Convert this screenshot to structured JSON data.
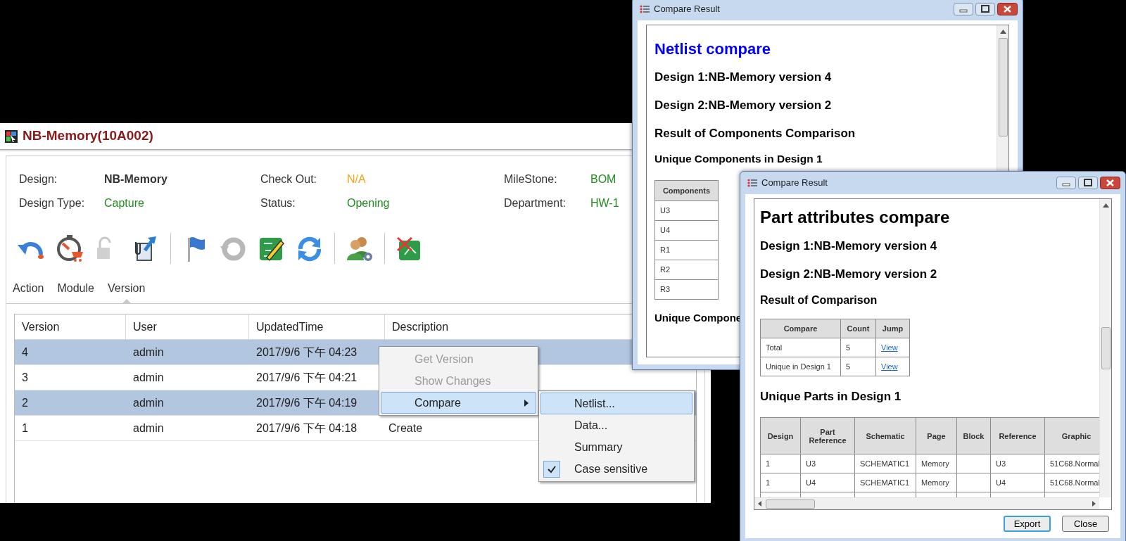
{
  "main_window": {
    "title": "NB-Memory(10A002)",
    "fields": [
      {
        "label": "Design:",
        "value": "NB-Memory",
        "color": "#333333",
        "bold": true
      },
      {
        "label": "Check Out:",
        "value": "N/A",
        "color": "#f5a31a",
        "bold": false
      },
      {
        "label": "MileStone:",
        "value": "BOM",
        "color": "#1f8a1f",
        "bold": false
      },
      {
        "label": "Design Type:",
        "value": "Capture",
        "color": "#1f8a1f",
        "bold": false
      },
      {
        "label": "Status:",
        "value": "Opening",
        "color": "#1f8a1f",
        "bold": false
      },
      {
        "label": "Department:",
        "value": "HW-1",
        "color": "#1f8a1f",
        "bold": false
      }
    ],
    "tabs": [
      {
        "label": "Action",
        "selected": false
      },
      {
        "label": "Module",
        "selected": false
      },
      {
        "label": "Version",
        "selected": true
      }
    ],
    "version_table": {
      "columns": [
        "Version",
        "User",
        "UpdatedTime",
        "Description"
      ],
      "rows": [
        {
          "version": "4",
          "user": "admin",
          "updated_time": "2017/9/6 下午 04:23",
          "selected": true
        },
        {
          "version": "3",
          "user": "admin",
          "updated_time": "2017/9/6 下午 04:21",
          "selected": false
        },
        {
          "version": "2",
          "user": "admin",
          "updated_time": "2017/9/6 下午 04:19",
          "selected": true
        },
        {
          "version": "1",
          "user": "admin",
          "updated_time": "2017/9/6 下午 04:18",
          "description": "Create",
          "selected": false
        }
      ]
    }
  },
  "context_menu": {
    "items": [
      {
        "label": "Get Version",
        "disabled": true,
        "selected": false,
        "submenu": false
      },
      {
        "label": "Show Changes",
        "disabled": true,
        "selected": false,
        "submenu": false
      },
      {
        "label": "Compare",
        "disabled": false,
        "selected": true,
        "submenu": true
      }
    ]
  },
  "submenu": {
    "items": [
      {
        "label": "Netlist...",
        "selected": true,
        "checked": false
      },
      {
        "label": "Data...",
        "selected": false,
        "checked": false
      },
      {
        "label": "Summary",
        "selected": false,
        "checked": false
      },
      {
        "label": "Case sensitive",
        "selected": false,
        "checked": true
      }
    ]
  },
  "netlist_window": {
    "title": "Compare Result",
    "heading": "Netlist compare",
    "design_lines": [
      "Design 1:NB-Memory version 4",
      "Design 2:NB-Memory version 2"
    ],
    "section_title": "Result of Components Comparison",
    "subsection_title": "Unique Components in Design 1",
    "components_table": {
      "column": "Components",
      "rows": [
        "U3",
        "U4",
        "R1",
        "R2",
        "R3"
      ]
    },
    "next_section": "Unique Compone"
  },
  "part_window": {
    "title": "Compare Result",
    "heading": "Part attributes compare",
    "design_lines": [
      "Design 1:NB-Memory version 4",
      "Design 2:NB-Memory version 2"
    ],
    "section_title": "Result of Comparison",
    "summary_table": {
      "columns": [
        "Compare",
        "Count",
        "Jump"
      ],
      "rows": [
        {
          "compare": "Total",
          "count": "5",
          "jump": "View"
        },
        {
          "compare": "Unique in Design 1",
          "count": "5",
          "jump": "View"
        }
      ]
    },
    "parts_title": "Unique Parts in Design 1",
    "parts_table": {
      "columns": [
        "Design",
        "Part Reference",
        "Schematic",
        "Page",
        "Block",
        "Reference",
        "Graphic"
      ],
      "rows": [
        {
          "design": "1",
          "part_reference": "U3",
          "schematic": "SCHEMATIC1",
          "page": "Memory",
          "reference": "U3",
          "graphic": "51C68.Normal"
        },
        {
          "design": "1",
          "part_reference": "U4",
          "schematic": "SCHEMATIC1",
          "page": "Memory",
          "reference": "U4",
          "graphic": "51C68.Normal"
        }
      ]
    },
    "buttons": [
      {
        "label": "Export",
        "default": true
      },
      {
        "label": "Close",
        "default": false
      }
    ]
  }
}
